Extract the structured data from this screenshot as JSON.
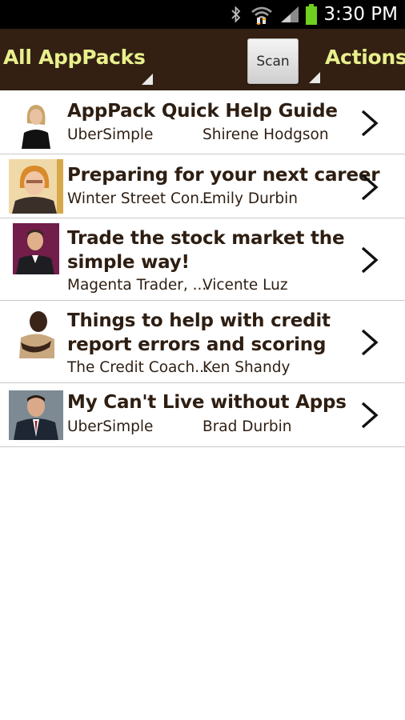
{
  "status_bar": {
    "time": "3:30 PM",
    "icons": [
      "bluetooth-icon",
      "wifi-icon",
      "signal-icon",
      "battery-icon"
    ]
  },
  "action_bar": {
    "title": "All AppPacks",
    "scan_label": "Scan",
    "actions_label": "Actions",
    "background_color": "#332012",
    "accent_color": "#e8f08d"
  },
  "apppacks": [
    {
      "title": "AppPack Quick Help Guide",
      "publisher": "UberSimple",
      "author": "Shirene Hodgson",
      "icon": "chevron-right-icon"
    },
    {
      "title": "Preparing for your next career",
      "publisher": "Winter Street Con...",
      "author": "Emily Durbin",
      "icon": "chevron-right-icon"
    },
    {
      "title_line1": "Trade the stock market the",
      "title_line2": "simple way!",
      "publisher": "Magenta Trader, ...",
      "author": "Vicente Luz",
      "icon": "chevron-right-icon"
    },
    {
      "title_line1": "Things to help with credit",
      "title_line2": "report errors and scoring",
      "publisher": "The Credit Coach...",
      "author": "Ken Shandy",
      "icon": "chevron-right-icon"
    },
    {
      "title": "My Can't Live without Apps",
      "publisher": "UberSimple",
      "author": "Brad Durbin",
      "icon": "chevron-right-icon"
    }
  ]
}
